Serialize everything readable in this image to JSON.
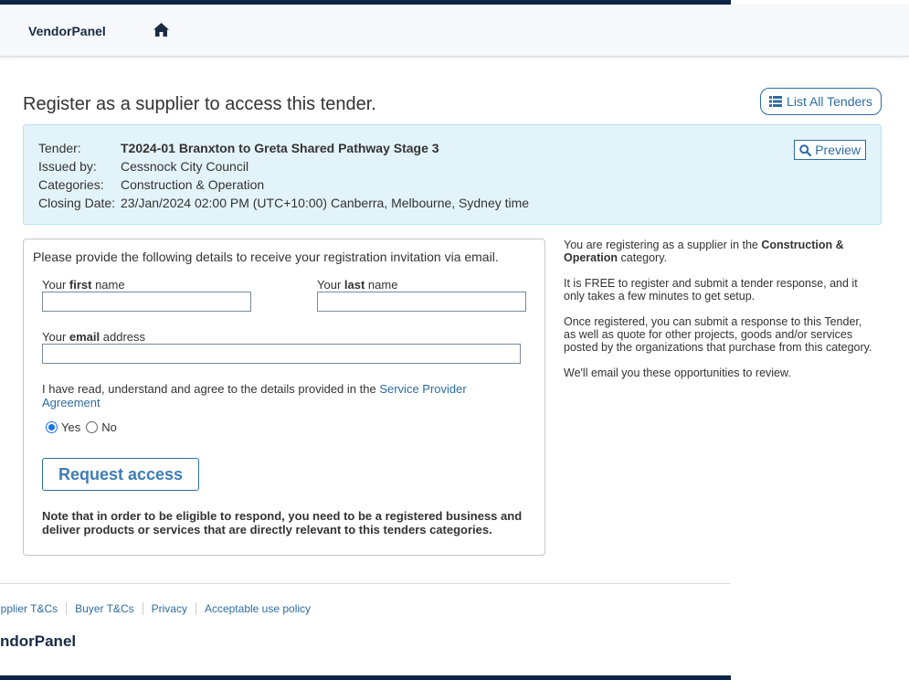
{
  "header": {
    "brand": "VendorPanel",
    "home_icon": "home-icon"
  },
  "page": {
    "title": "Register as a supplier to access this tender.",
    "list_button_label": "List All Tenders",
    "list_button_icon": "list-icon"
  },
  "tender": {
    "labels": {
      "tender": "Tender:",
      "issued_by": "Issued by:",
      "categories": "Categories:",
      "closing_date": "Closing Date:"
    },
    "name": "T2024-01 Branxton to Greta Shared Pathway Stage 3",
    "issued_by": "Cessnock City Council",
    "categories": "Construction & Operation",
    "closing_date": "23/Jan/2024 02:00 PM (UTC+10:00) Canberra, Melbourne, Sydney time",
    "preview_label": "Preview",
    "preview_icon": "search-icon"
  },
  "form": {
    "intro": "Please provide the following details to receive your registration invitation via email.",
    "first_name": {
      "prefix": "Your ",
      "bold": "first",
      "suffix": " name",
      "value": ""
    },
    "last_name": {
      "prefix": "Your ",
      "bold": "last",
      "suffix": " name",
      "value": ""
    },
    "email": {
      "prefix": "Your ",
      "bold": "email",
      "suffix": " address",
      "value": ""
    },
    "agree_text": "I have read, understand and agree to the details provided in the ",
    "agree_link": "Service Provider Agreement",
    "yes_label": "Yes",
    "no_label": "No",
    "selected": "Yes",
    "submit_label": "Request access",
    "note": "Note that in order to be eligible to respond, you need to be a registered business and deliver products or services that are directly relevant to this tenders categories."
  },
  "sidebar": {
    "p1_prefix": "You are registering as a supplier in the ",
    "p1_bold": "Construction & Operation",
    "p1_suffix": " category.",
    "p2": "It is FREE to register and submit a tender response, and it only takes a few minutes to get setup.",
    "p3": "Once registered, you can submit a response to this Tender, as well as quote for other projects, goods and/or services posted by the organizations that purchase from this category.",
    "p4": "We'll email you these opportunities to review."
  },
  "footer": {
    "links": [
      "upplier T&Cs",
      "Buyer T&Cs",
      "Privacy",
      "Acceptable use policy"
    ],
    "brand": "ndorPanel"
  },
  "colors": {
    "navy": "#0b2447",
    "link": "#2d6ca2",
    "panel_bg": "#e3f3fa"
  }
}
